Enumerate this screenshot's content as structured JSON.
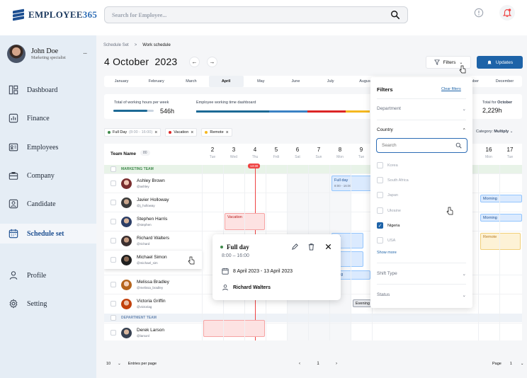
{
  "app": {
    "logo_prefix": "EMPLOYEE",
    "logo_suffix": "365"
  },
  "search": {
    "placeholder": "Search for Employee..."
  },
  "user": {
    "name": "John Doe",
    "role": "Marketing specialist",
    "menu": "..."
  },
  "nav": [
    {
      "label": "Dashboard",
      "icon": "dashboard-icon"
    },
    {
      "label": "Finance",
      "icon": "finance-icon"
    },
    {
      "label": "Employees",
      "icon": "employees-icon"
    },
    {
      "label": "Company",
      "icon": "company-icon"
    },
    {
      "label": "Candidate",
      "icon": "candidate-icon"
    },
    {
      "label": "Schedule set",
      "icon": "calendar-icon",
      "active": true
    },
    {
      "label": "Profile",
      "icon": "profile-icon"
    },
    {
      "label": "Setting",
      "icon": "gear-icon"
    }
  ],
  "breadcrumb": {
    "parent": "Schedule Set",
    "sep": ">",
    "current": "Work schedule"
  },
  "title": {
    "date": "4 October",
    "year": "2023"
  },
  "toolbar": {
    "filters": "Filters",
    "updates": "Updates"
  },
  "months": [
    "January",
    "February",
    "March",
    "April",
    "May",
    "June",
    "July",
    "August",
    "September",
    "October",
    "November",
    "December"
  ],
  "selected_month": "April",
  "stats": {
    "hours_label": "Total of working hours per week",
    "hours_value": "546h",
    "hours_progress": 0.85,
    "dashboard_label": "Employee working time dashboard",
    "dashboard_segments": [
      {
        "color": "#1d6a96",
        "share": 0.42
      },
      {
        "color": "#3b82c4",
        "share": 0.22
      },
      {
        "color": "#dc2626",
        "share": 0.22
      },
      {
        "color": "#f5b820",
        "share": 0.14
      }
    ],
    "total_label_prefix": "Total for",
    "total_month": "October",
    "total_value": "2,229h"
  },
  "chips": [
    {
      "label": "Full Day",
      "detail": "(8:00 - 16:00)",
      "color": "#3f8a4b",
      "x": "×"
    },
    {
      "label": "Vacation",
      "color": "#dc2626",
      "x": "×"
    },
    {
      "label": "Remote",
      "color": "#f5b820",
      "x": "×"
    }
  ],
  "category": {
    "label": "Category:",
    "value": "Multiply"
  },
  "grid": {
    "header": "Team Name",
    "count": "80",
    "days": [
      {
        "n": "2",
        "w": "Tue"
      },
      {
        "n": "3",
        "w": "Wed"
      },
      {
        "n": "4",
        "w": "Thu"
      },
      {
        "n": "5",
        "w": "Frdi"
      },
      {
        "n": "6",
        "w": "Sat"
      },
      {
        "n": "7",
        "w": "Sun"
      },
      {
        "n": "8",
        "w": "Mon"
      },
      {
        "n": "9",
        "w": "Tue"
      },
      {
        "n": "16",
        "w": "Mon"
      },
      {
        "n": "17",
        "w": "Tue"
      }
    ],
    "now": "13:30",
    "teams": {
      "marketing": "MARKETING TEAM",
      "department": "DEPARTMENT TEAM"
    },
    "rows": [
      {
        "name": "Ashley Brown",
        "handle": "@ashley"
      },
      {
        "name": "Javier Holloway",
        "handle": "@j_holloway"
      },
      {
        "name": "Stephen Harris",
        "handle": "@stephen"
      },
      {
        "name": "Richard Walters",
        "handle": "@richard"
      },
      {
        "name": "Michael Simon",
        "handle": "@michael_sim"
      },
      {
        "name": "Melissa Bradley",
        "handle": "@melissa_bradley"
      },
      {
        "name": "Victoria Griffin",
        "handle": "@victoriag"
      },
      {
        "name": "Derek Larson",
        "handle": "@larsonl"
      }
    ],
    "events": {
      "fullday": "Full day",
      "fullday_time": "8:00 - 16:00",
      "vacation": "Vacation",
      "morning": "Morning",
      "remote": "Remote",
      "evening": "Evening",
      "day": "day",
      "rning": "rning"
    }
  },
  "popup": {
    "title": "Full day",
    "time": "8:00 – 16:00",
    "dates": "8 April 2023 - 13 April 2023",
    "user": "Richard Walters"
  },
  "filter_panel": {
    "title": "Filters",
    "clear": "Clear filters",
    "department": "Department",
    "country": "Country",
    "search_placeholder": "Search",
    "options": [
      {
        "label": "Korea",
        "checked": false
      },
      {
        "label": "South Africa",
        "checked": false
      },
      {
        "label": "Japan",
        "checked": false
      },
      {
        "label": "Ukraine",
        "checked": false
      },
      {
        "label": "Nigeria",
        "checked": true
      },
      {
        "label": "USA",
        "checked": false
      }
    ],
    "show_more": "Show more",
    "shift_type": "Shift Type",
    "status": "Status"
  },
  "footer": {
    "per_page": "10",
    "per_page_label": "Entries per page",
    "page": "1",
    "page_label": "Page",
    "page_total": "1"
  }
}
